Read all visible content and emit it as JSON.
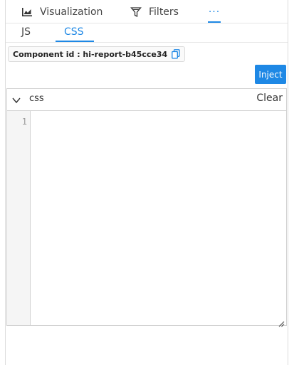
{
  "tabs": {
    "visualization": "Visualization",
    "filters": "Filters",
    "more": "···"
  },
  "code_tabs": {
    "js": "JS",
    "css": "CSS",
    "active": "CSS"
  },
  "component": {
    "label": "Component id : hi-report-b45cce34"
  },
  "inject_button": "Inject",
  "editor": {
    "language": "css",
    "clear_label": "Clear",
    "line_number": "1",
    "content": ""
  },
  "colors": {
    "accent": "#1e88e5"
  }
}
